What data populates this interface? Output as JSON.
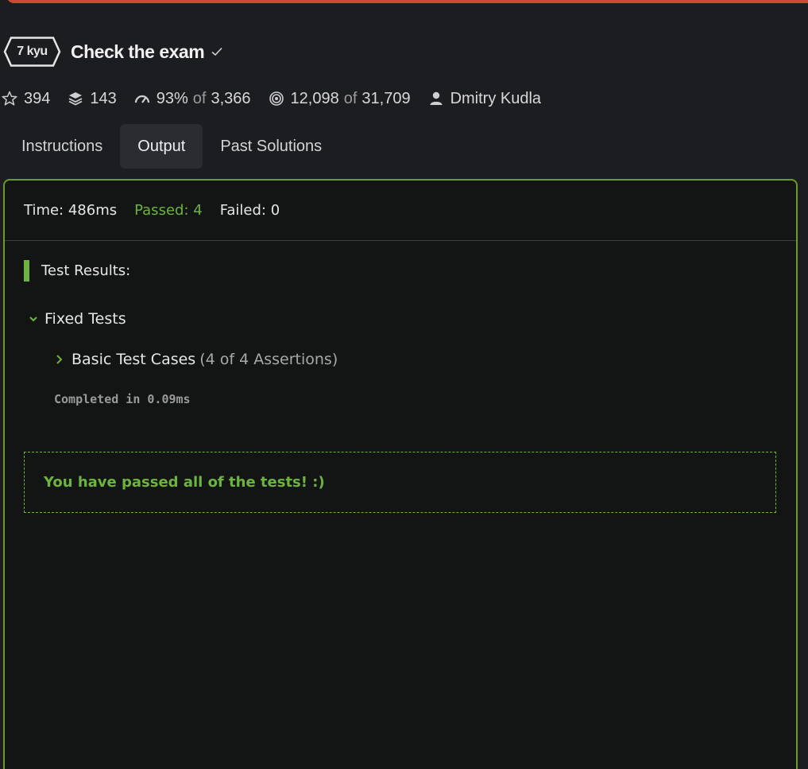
{
  "kata": {
    "rank": "7 kyu",
    "title": "Check the exam"
  },
  "stats": {
    "stars": "394",
    "collections": "143",
    "satisfaction": "93%",
    "satisfaction_of": "of",
    "satisfaction_votes": "3,366",
    "completed": "12,098",
    "completed_of": "of",
    "attempted": "31,709",
    "author": "Dmitry Kudla"
  },
  "tabs": [
    {
      "label": "Instructions",
      "active": false
    },
    {
      "label": "Output",
      "active": true
    },
    {
      "label": "Past Solutions",
      "active": false
    }
  ],
  "output": {
    "time": "Time: 486ms",
    "passed": "Passed: 4",
    "failed": "Failed: 0",
    "results_title": "Test Results:",
    "group_label": "Fixed Tests",
    "case_label": "Basic Test Cases",
    "case_assertions": "(4 of 4 Assertions)",
    "completed_in": "Completed in 0.09ms",
    "success_message": "You have passed all of the tests! :)"
  },
  "colors": {
    "accent_green": "#6db33f",
    "panel_border": "#6a9a2a",
    "top_bar": "#cf4a36"
  },
  "icons": {
    "rank": "hexagon-badge",
    "solved": "check-icon",
    "stars": "star-icon",
    "collections": "layers-icon",
    "satisfaction": "gauge-icon",
    "completed": "target-icon",
    "author": "user-icon",
    "group": "chevron-down-icon",
    "case": "chevron-right-icon"
  }
}
